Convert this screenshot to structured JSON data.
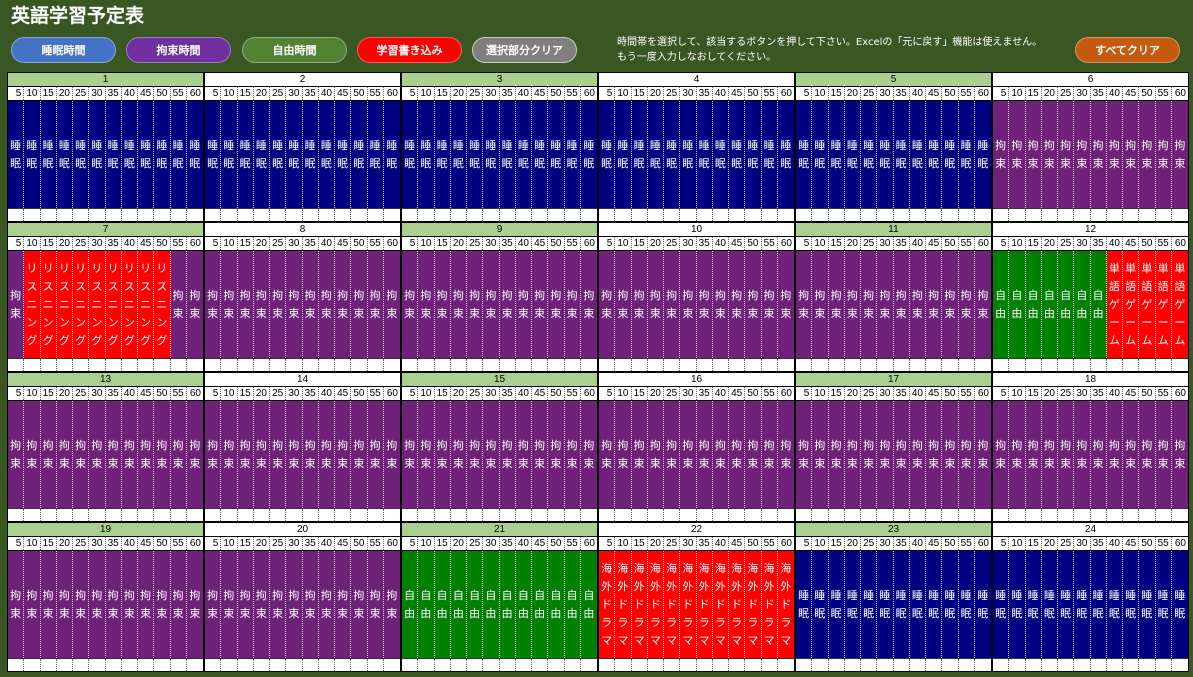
{
  "title": "英語学習予定表",
  "buttons": {
    "sleep": {
      "label": "睡眠時間",
      "color": "#4472C4"
    },
    "bound": {
      "label": "拘束時間",
      "color": "#7030A0"
    },
    "free": {
      "label": "自由時間",
      "color": "#548235"
    },
    "study": {
      "label": "学習書き込み",
      "color": "#FF0000"
    },
    "clear_selection": {
      "label": "選択部分クリア",
      "color": "#7F7F7F"
    },
    "clear_all": {
      "label": "すべてクリア",
      "color": "#C55A11"
    }
  },
  "instructions": {
    "line1": "時間帯を選択して、該当するボタンを押して下さい。Excelの「元に戻す」機能は使えません。",
    "line2": "もう一度入力しなおしてください。"
  },
  "colors": {
    "background": "#385723",
    "hour_header_odd": "#A9D08E",
    "hour_header_even": "#FFFFFF"
  },
  "cell_colors": {
    "睡眠": "#000080",
    "拘束": "#6F217A",
    "自由": "#008000",
    "リスニング": "#FF0000",
    "単語ゲーム": "#FF0000",
    "海外ドラマ": "#FF0000"
  },
  "minute_labels": [
    "5",
    "10",
    "15",
    "20",
    "25",
    "30",
    "35",
    "40",
    "45",
    "50",
    "55",
    "60"
  ],
  "hours": [
    {
      "hour": "1",
      "slots": [
        "睡眠",
        "睡眠",
        "睡眠",
        "睡眠",
        "睡眠",
        "睡眠",
        "睡眠",
        "睡眠",
        "睡眠",
        "睡眠",
        "睡眠",
        "睡眠"
      ]
    },
    {
      "hour": "2",
      "slots": [
        "睡眠",
        "睡眠",
        "睡眠",
        "睡眠",
        "睡眠",
        "睡眠",
        "睡眠",
        "睡眠",
        "睡眠",
        "睡眠",
        "睡眠",
        "睡眠"
      ]
    },
    {
      "hour": "3",
      "slots": [
        "睡眠",
        "睡眠",
        "睡眠",
        "睡眠",
        "睡眠",
        "睡眠",
        "睡眠",
        "睡眠",
        "睡眠",
        "睡眠",
        "睡眠",
        "睡眠"
      ]
    },
    {
      "hour": "4",
      "slots": [
        "睡眠",
        "睡眠",
        "睡眠",
        "睡眠",
        "睡眠",
        "睡眠",
        "睡眠",
        "睡眠",
        "睡眠",
        "睡眠",
        "睡眠",
        "睡眠"
      ]
    },
    {
      "hour": "5",
      "slots": [
        "睡眠",
        "睡眠",
        "睡眠",
        "睡眠",
        "睡眠",
        "睡眠",
        "睡眠",
        "睡眠",
        "睡眠",
        "睡眠",
        "睡眠",
        "睡眠"
      ]
    },
    {
      "hour": "6",
      "slots": [
        "拘束",
        "拘束",
        "拘束",
        "拘束",
        "拘束",
        "拘束",
        "拘束",
        "拘束",
        "拘束",
        "拘束",
        "拘束",
        "拘束"
      ]
    },
    {
      "hour": "7",
      "slots": [
        "拘束",
        "リスニング",
        "リスニング",
        "リスニング",
        "リスニング",
        "リスニング",
        "リスニング",
        "リスニング",
        "リスニング",
        "リスニング",
        "拘束",
        "拘束"
      ]
    },
    {
      "hour": "8",
      "slots": [
        "拘束",
        "拘束",
        "拘束",
        "拘束",
        "拘束",
        "拘束",
        "拘束",
        "拘束",
        "拘束",
        "拘束",
        "拘束",
        "拘束"
      ]
    },
    {
      "hour": "9",
      "slots": [
        "拘束",
        "拘束",
        "拘束",
        "拘束",
        "拘束",
        "拘束",
        "拘束",
        "拘束",
        "拘束",
        "拘束",
        "拘束",
        "拘束"
      ]
    },
    {
      "hour": "10",
      "slots": [
        "拘束",
        "拘束",
        "拘束",
        "拘束",
        "拘束",
        "拘束",
        "拘束",
        "拘束",
        "拘束",
        "拘束",
        "拘束",
        "拘束"
      ]
    },
    {
      "hour": "11",
      "slots": [
        "拘束",
        "拘束",
        "拘束",
        "拘束",
        "拘束",
        "拘束",
        "拘束",
        "拘束",
        "拘束",
        "拘束",
        "拘束",
        "拘束"
      ]
    },
    {
      "hour": "12",
      "slots": [
        "自由",
        "自由",
        "自由",
        "自由",
        "自由",
        "自由",
        "自由",
        "単語ゲーム",
        "単語ゲーム",
        "単語ゲーム",
        "単語ゲーム",
        "単語ゲーム"
      ]
    },
    {
      "hour": "13",
      "slots": [
        "拘束",
        "拘束",
        "拘束",
        "拘束",
        "拘束",
        "拘束",
        "拘束",
        "拘束",
        "拘束",
        "拘束",
        "拘束",
        "拘束"
      ]
    },
    {
      "hour": "14",
      "slots": [
        "拘束",
        "拘束",
        "拘束",
        "拘束",
        "拘束",
        "拘束",
        "拘束",
        "拘束",
        "拘束",
        "拘束",
        "拘束",
        "拘束"
      ]
    },
    {
      "hour": "15",
      "slots": [
        "拘束",
        "拘束",
        "拘束",
        "拘束",
        "拘束",
        "拘束",
        "拘束",
        "拘束",
        "拘束",
        "拘束",
        "拘束",
        "拘束"
      ]
    },
    {
      "hour": "16",
      "slots": [
        "拘束",
        "拘束",
        "拘束",
        "拘束",
        "拘束",
        "拘束",
        "拘束",
        "拘束",
        "拘束",
        "拘束",
        "拘束",
        "拘束"
      ]
    },
    {
      "hour": "17",
      "slots": [
        "拘束",
        "拘束",
        "拘束",
        "拘束",
        "拘束",
        "拘束",
        "拘束",
        "拘束",
        "拘束",
        "拘束",
        "拘束",
        "拘束"
      ]
    },
    {
      "hour": "18",
      "slots": [
        "拘束",
        "拘束",
        "拘束",
        "拘束",
        "拘束",
        "拘束",
        "拘束",
        "拘束",
        "拘束",
        "拘束",
        "拘束",
        "拘束"
      ]
    },
    {
      "hour": "19",
      "slots": [
        "拘束",
        "拘束",
        "拘束",
        "拘束",
        "拘束",
        "拘束",
        "拘束",
        "拘束",
        "拘束",
        "拘束",
        "拘束",
        "拘束"
      ]
    },
    {
      "hour": "20",
      "slots": [
        "拘束",
        "拘束",
        "拘束",
        "拘束",
        "拘束",
        "拘束",
        "拘束",
        "拘束",
        "拘束",
        "拘束",
        "拘束",
        "拘束"
      ]
    },
    {
      "hour": "21",
      "slots": [
        "自由",
        "自由",
        "自由",
        "自由",
        "自由",
        "自由",
        "自由",
        "自由",
        "自由",
        "自由",
        "自由",
        "自由"
      ]
    },
    {
      "hour": "22",
      "slots": [
        "海外ドラマ",
        "海外ドラマ",
        "海外ドラマ",
        "海外ドラマ",
        "海外ドラマ",
        "海外ドラマ",
        "海外ドラマ",
        "海外ドラマ",
        "海外ドラマ",
        "海外ドラマ",
        "海外ドラマ",
        "海外ドラマ"
      ]
    },
    {
      "hour": "23",
      "slots": [
        "睡眠",
        "睡眠",
        "睡眠",
        "睡眠",
        "睡眠",
        "睡眠",
        "睡眠",
        "睡眠",
        "睡眠",
        "睡眠",
        "睡眠",
        "睡眠"
      ]
    },
    {
      "hour": "24",
      "slots": [
        "睡眠",
        "睡眠",
        "睡眠",
        "睡眠",
        "睡眠",
        "睡眠",
        "睡眠",
        "睡眠",
        "睡眠",
        "睡眠",
        "睡眠",
        "睡眠"
      ]
    }
  ]
}
